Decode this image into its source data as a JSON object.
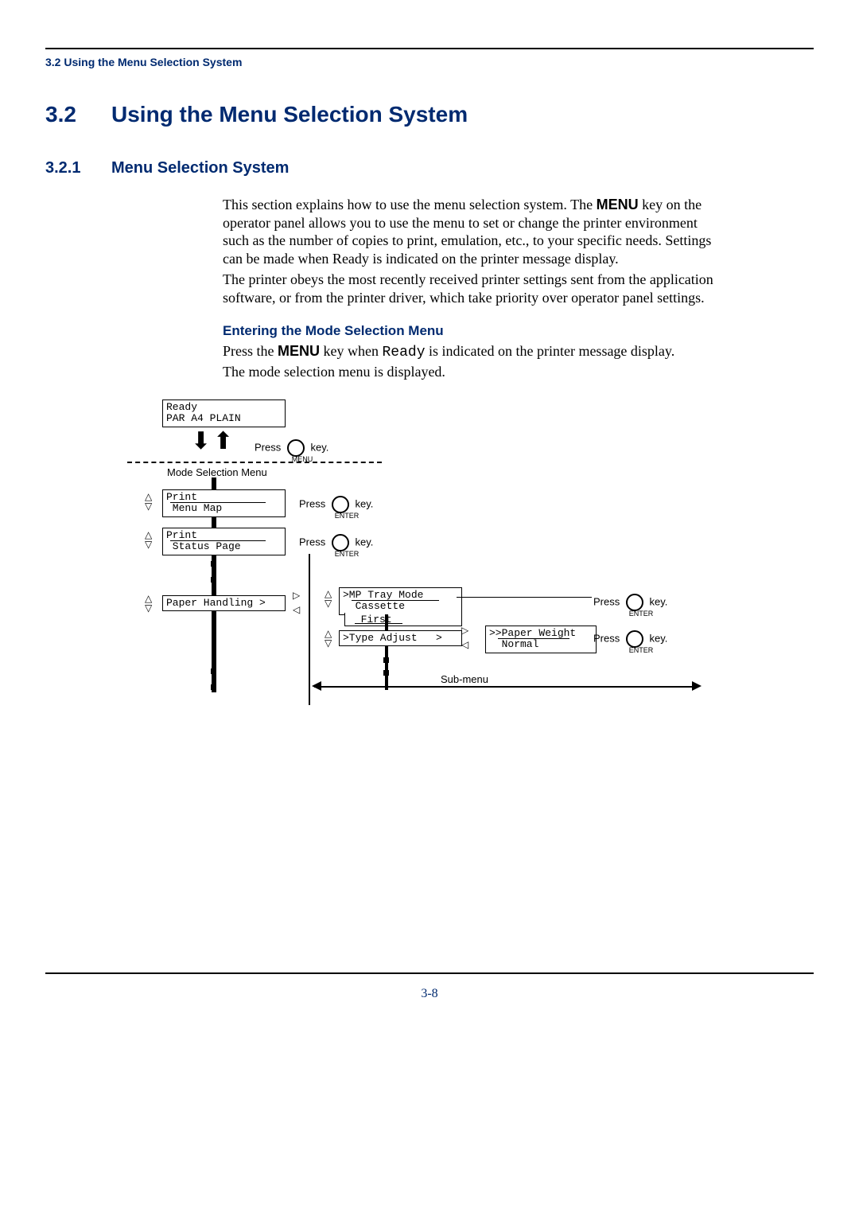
{
  "header": {
    "running": "3.2 Using the Menu Selection System"
  },
  "section": {
    "num": "3.2",
    "title": "Using the Menu Selection System"
  },
  "subsection": {
    "num": "3.2.1",
    "title": "Menu Selection System"
  },
  "para1_a": "This section explains how to use the menu selection system. The ",
  "para1_bold": "MENU",
  "para1_b": " key on the operator panel allows you to use the menu to set or change the printer environment such as the number of copies to print, emulation, etc., to your specific needs. Settings can be made when Ready is indicated on the printer message display.",
  "para2": "The printer obeys the most recently received printer settings sent from the application software, or from the printer driver, which take priority over operator panel settings.",
  "subheading": "Entering the Mode Selection Menu",
  "para3_a": "Press the ",
  "para3_bold": "MENU",
  "para3_b": " key when ",
  "para3_mono": "Ready",
  "para3_c": " is indicated on the printer message display.",
  "para4": "The mode selection menu is displayed.",
  "diagram": {
    "ready_lcd": "Ready\nPAR A4 PLAIN",
    "press": "Press",
    "key": " key.",
    "menu_key": "MENU",
    "enter_key": "ENTER",
    "mode_label": "Mode Selection Menu",
    "lcd_print_menu": "Print\n Menu Map",
    "lcd_print_status": "Print\n Status Page",
    "lcd_paper_handling": "Paper Handling >",
    "lcd_mp_tray": ">MP Tray Mode\n  Cassette",
    "lcd_first": "First",
    "lcd_type_adjust": ">Type Adjust   >",
    "lcd_paper_weight": ">>Paper Weight\n  Normal",
    "sub_menu": "Sub-menu"
  },
  "page_number": "3-8"
}
